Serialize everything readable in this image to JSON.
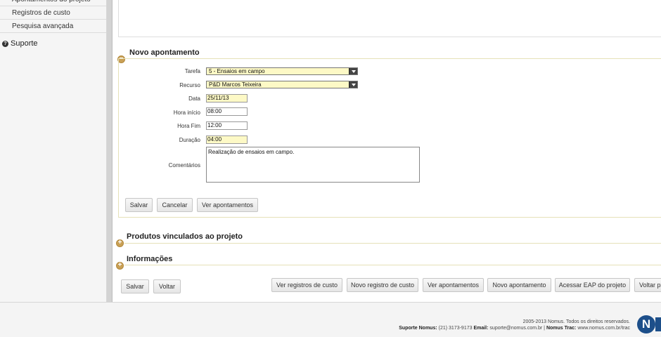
{
  "sidebar": {
    "items": [
      {
        "label": "Apontamentos do projeto"
      },
      {
        "label": "Registros de custo"
      },
      {
        "label": "Pesquisa avançada"
      }
    ],
    "support_label": "Suporte"
  },
  "novo_apontamento": {
    "title": "Novo apontamento",
    "fields": {
      "tarefa": {
        "label": "Tarefa",
        "value": "5 - Ensaios em campo"
      },
      "recurso": {
        "label": "Recurso",
        "value": "P&D Marcos Teixeira"
      },
      "data": {
        "label": "Data",
        "value": "25/11/13"
      },
      "hora_inicio": {
        "label": "Hora início",
        "value": "08:00"
      },
      "hora_fim": {
        "label": "Hora Fim",
        "value": "12:00"
      },
      "duracao": {
        "label": "Duração",
        "value": "04:00"
      },
      "comentarios": {
        "label": "Comentários",
        "value": "Realização de ensaios em campo."
      }
    },
    "buttons": {
      "salvar": "Salvar",
      "cancelar": "Cancelar",
      "ver_apontamentos": "Ver apontamentos"
    }
  },
  "sections": {
    "produtos": "Produtos vinculados ao projeto",
    "informacoes": "Informações"
  },
  "bottom_buttons": {
    "salvar": "Salvar",
    "voltar": "Voltar",
    "ver_registros": "Ver registros de custo",
    "novo_registro": "Novo registro de custo",
    "ver_apontamentos": "Ver apontamentos",
    "novo_apontamento": "Novo apontamento",
    "acessar_eap": "Acessar EAP do projeto",
    "voltar_pa": "Voltar pa"
  },
  "footer": {
    "copyright": "2005-2013 Nomus. Todos os direitos reservados.",
    "suporte_label": "Suporte Nomus:",
    "suporte_phone": "(21) 3173-9173",
    "email_label": "Email:",
    "email": "suporte@nomus.com.br |",
    "trac_label": "Nomus Trac:",
    "trac_url": "www.nomus.com.br/trac",
    "logo_letter": "N"
  },
  "colors": {
    "accent_toggle": "#c9a055",
    "field_highlight": "#fdf9c6",
    "logo": "#1d4f8a"
  }
}
